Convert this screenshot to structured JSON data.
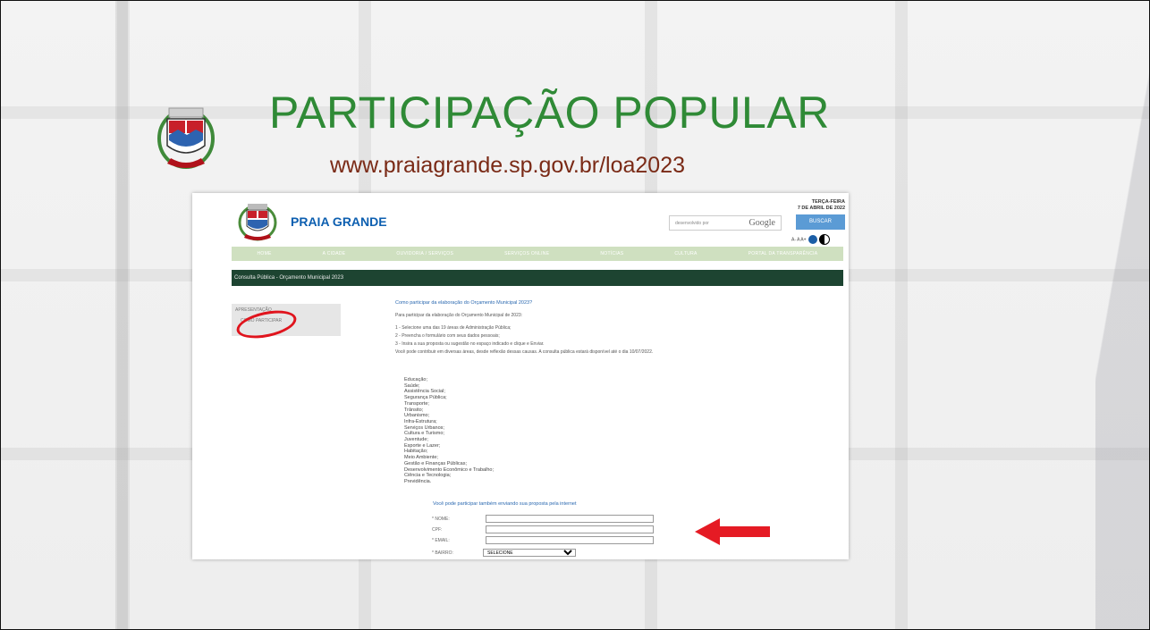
{
  "slide": {
    "title": "PARTICIPAÇÃO POPULAR",
    "url": "www.praiagrande.sp.gov.br/loa2023"
  },
  "site": {
    "brand": "PRAIA GRANDE",
    "date_line1": "TERÇA-FEIRA",
    "date_line2": "7 DE ABRIL DE 2022",
    "search_placeholder": "desenvolvido por",
    "search_brand": "Google",
    "search_button": "BUSCAR",
    "access_label": "A- A A+",
    "nav": [
      "HOME",
      "A CIDADE",
      "OUVIDORIA / SERVIÇOS",
      "SERVIÇOS ONLINE",
      "NOTÍCIAS",
      "CULTURA",
      "PORTAL DA TRANSPARÊNCIA"
    ],
    "breadcrumb": "Consulta Pública - Orçamento Municipal 2023",
    "sidebar": {
      "item1": "APRESENTAÇÃO",
      "item2": "COMO PARTICIPAR"
    },
    "content": {
      "question": "Como participar da elaboração do Orçamento Municipal 2023?",
      "intro": "Para participar da elaboração do Orçamento Municipal de 2023:",
      "step1": "1 - Selecione uma das 19 áreas de Administração Pública;",
      "step2": "2 - Preencha o formulário com seus dados pessoais;",
      "step3": "3 - Insira a sua proposta ou sugestão no espaço indicado e clique e Enviar.",
      "note": "Você pode contribuir em diversas áreas, desde reflexão dessas causas. A consulta pública estará disponível até o dia 10/07/2022."
    },
    "areas": [
      "Educação;",
      "Saúde;",
      "Assistência Social;",
      "Segurança Pública;",
      "Transporte;",
      "Trânsito;",
      "Urbanismo;",
      "Infra-Estrutura;",
      "Serviços Urbanos;",
      "Cultura e Turismo;",
      "Juventude;",
      "Esporte e Lazer;",
      "Habitação;",
      "Meio Ambiente;",
      "Gestão e Finanças Públicas;",
      "Desenvolvimento Econômico e Trabalho;",
      "Ciência e Tecnologia;",
      "Previdência."
    ],
    "form_note": "Você pode participar também enviando sua proposta pela internet",
    "form": {
      "name_label": "* NOME:",
      "cpf_label": "CPF:",
      "email_label": "* EMAIL:",
      "bairro_label": "* BAIRRO:",
      "bairro_value": "SELECIONE"
    }
  }
}
